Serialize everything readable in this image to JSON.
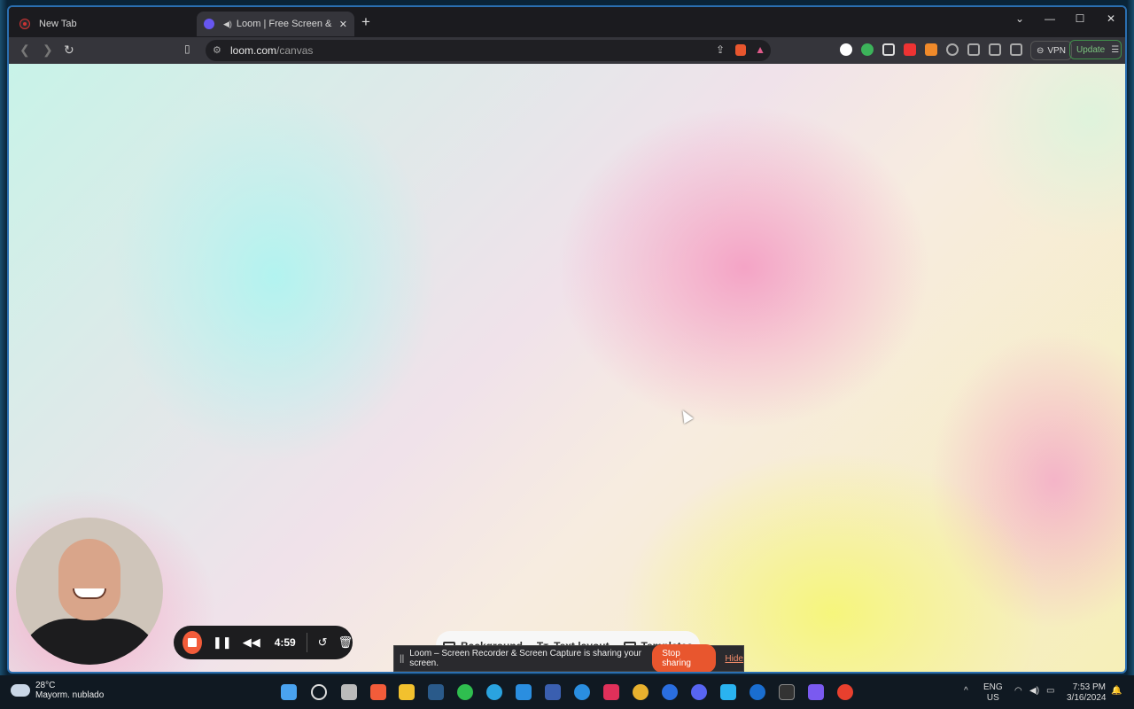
{
  "browser": {
    "tabs": [
      {
        "label": "New Tab"
      },
      {
        "label": "Loom | Free Screen & Video Recording"
      }
    ],
    "new_tab_glyph": "+",
    "window_controls": {
      "collapse": "⌄",
      "minimize": "—",
      "maximize": "☐",
      "close": "✕"
    },
    "url": {
      "host": "loom.com",
      "path": "/canvas"
    },
    "vpn_label": "VPN",
    "update_label": "Update"
  },
  "canvas_menu": {
    "items": [
      {
        "label": "Background",
        "icon": "image-icon"
      },
      {
        "label": "Text layout",
        "icon": "text-icon"
      },
      {
        "label": "Templates",
        "icon": "template-icon"
      }
    ]
  },
  "recorder": {
    "timer": "4:59"
  },
  "share_notice": {
    "message": "Loom – Screen Recorder & Screen Capture is sharing your screen.",
    "stop_label": "Stop sharing",
    "hide_label": "Hide"
  },
  "taskbar": {
    "weather_temp": "28°C",
    "weather_desc": "Mayorm. nublado",
    "language": "ENG",
    "region": "US",
    "time": "7:53 PM",
    "date": "3/16/2024"
  },
  "colors": {
    "accent_stop": "#f25c3a",
    "share_button": "#e8562e",
    "window_border": "#2b6fb1"
  }
}
